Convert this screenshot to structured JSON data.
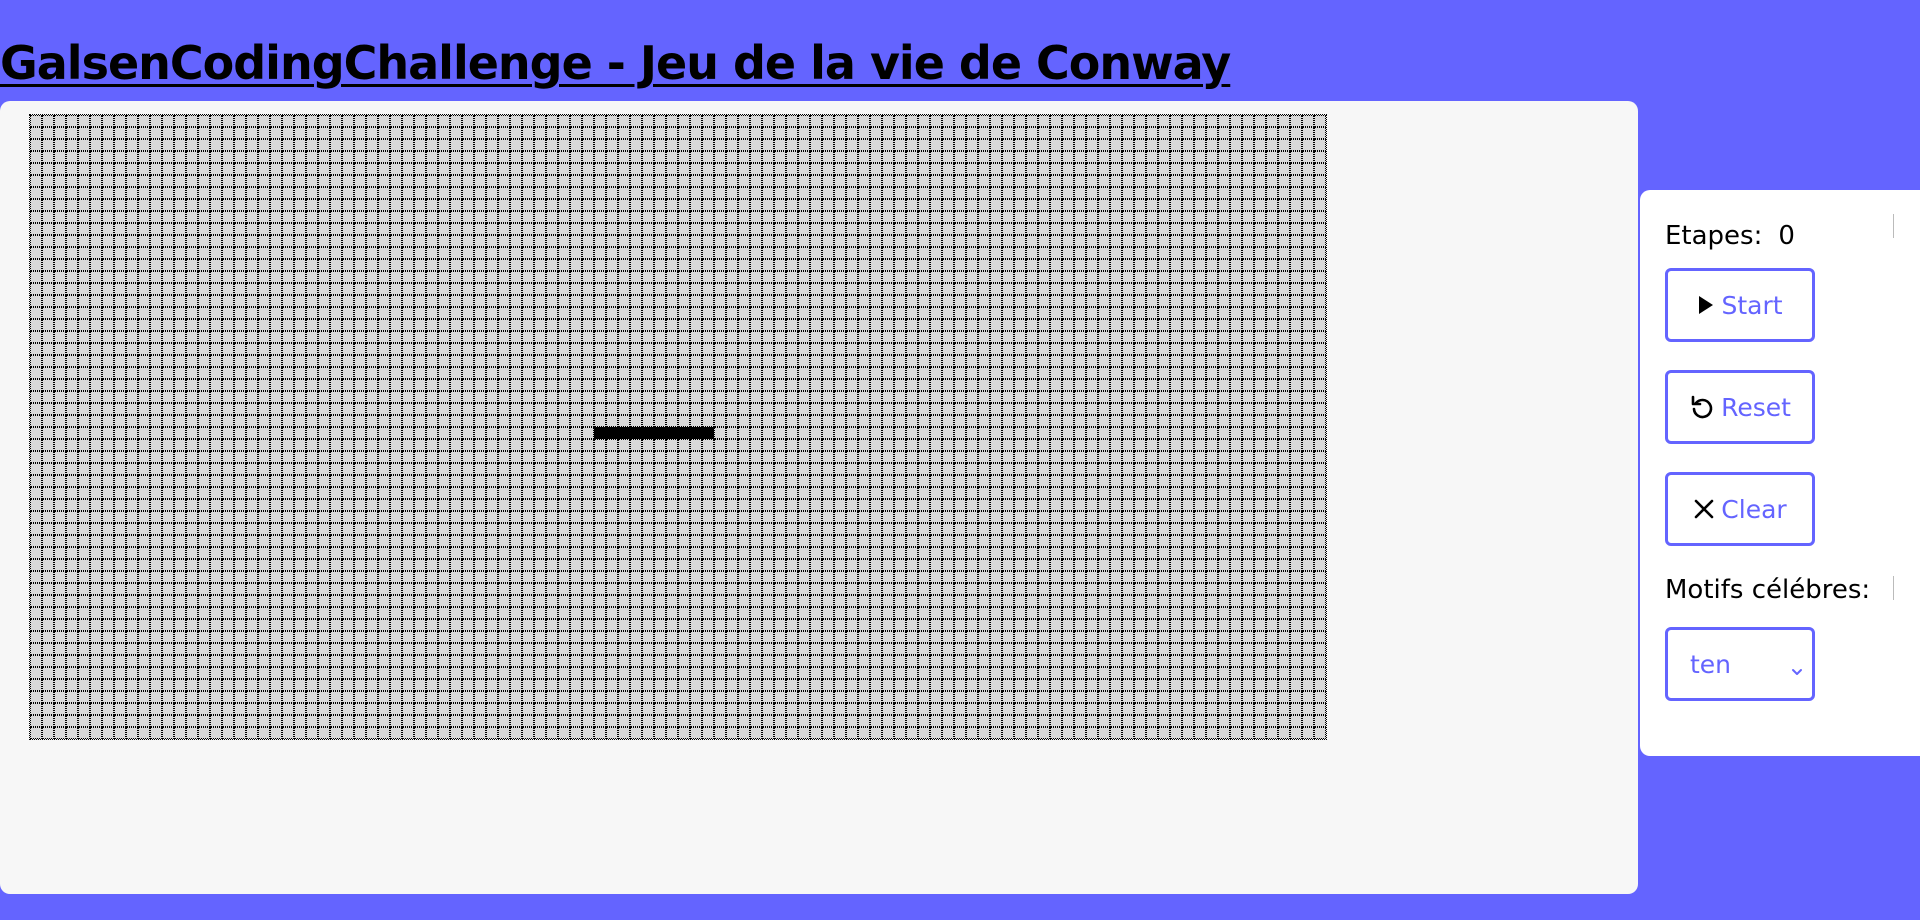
{
  "page": {
    "title": "GalsenCodingChallenge - Jeu de la vie de Conway"
  },
  "board": {
    "columns": 108,
    "rows": 52,
    "alive_cells": [
      [
        26,
        47
      ],
      [
        26,
        48
      ],
      [
        26,
        49
      ],
      [
        26,
        50
      ],
      [
        26,
        51
      ],
      [
        26,
        52
      ],
      [
        26,
        53
      ],
      [
        26,
        54
      ],
      [
        26,
        55
      ],
      [
        26,
        56
      ]
    ],
    "colors": {
      "dead": "#d9d9d9",
      "alive": "#000000",
      "grid_line": "#000000"
    }
  },
  "controls": {
    "steps_label": "Etapes:",
    "steps_value": "0",
    "start_label": "Start",
    "reset_label": "Reset",
    "clear_label": "Clear",
    "motifs_label": "Motifs célébres:",
    "motifs_selected": "ten",
    "icons": {
      "start": "play-icon",
      "reset": "reset-icon",
      "clear": "close-icon",
      "select": "chevron-down-icon"
    }
  },
  "colors": {
    "background": "#6464ff",
    "accent": "#6464ff",
    "panel": "#ffffff",
    "board_panel": "#f7f7f7"
  }
}
